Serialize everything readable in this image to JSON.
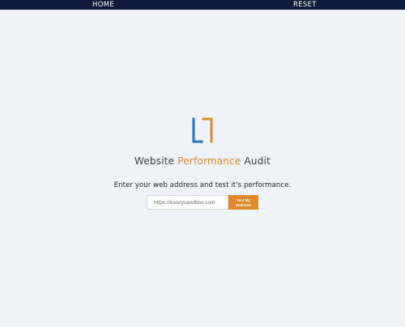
{
  "nav": {
    "home_label": "HOME",
    "reset_label": "RESET"
  },
  "logo": {
    "icon": "brand-logo-icon",
    "colors": {
      "blue": "#2475b8",
      "orange": "#e0892a"
    }
  },
  "hero": {
    "title_prefix": "Website ",
    "title_accent": "Performance",
    "title_suffix": " Audit",
    "subtitle": "Enter your web address and test it's performance."
  },
  "form": {
    "url_placeholder": "https://luxurysandbox.com",
    "submit_label": "Test My Website!"
  },
  "colors": {
    "topbar": "#0d1a38",
    "background": "#eff3f8",
    "accent": "#e0892a"
  }
}
